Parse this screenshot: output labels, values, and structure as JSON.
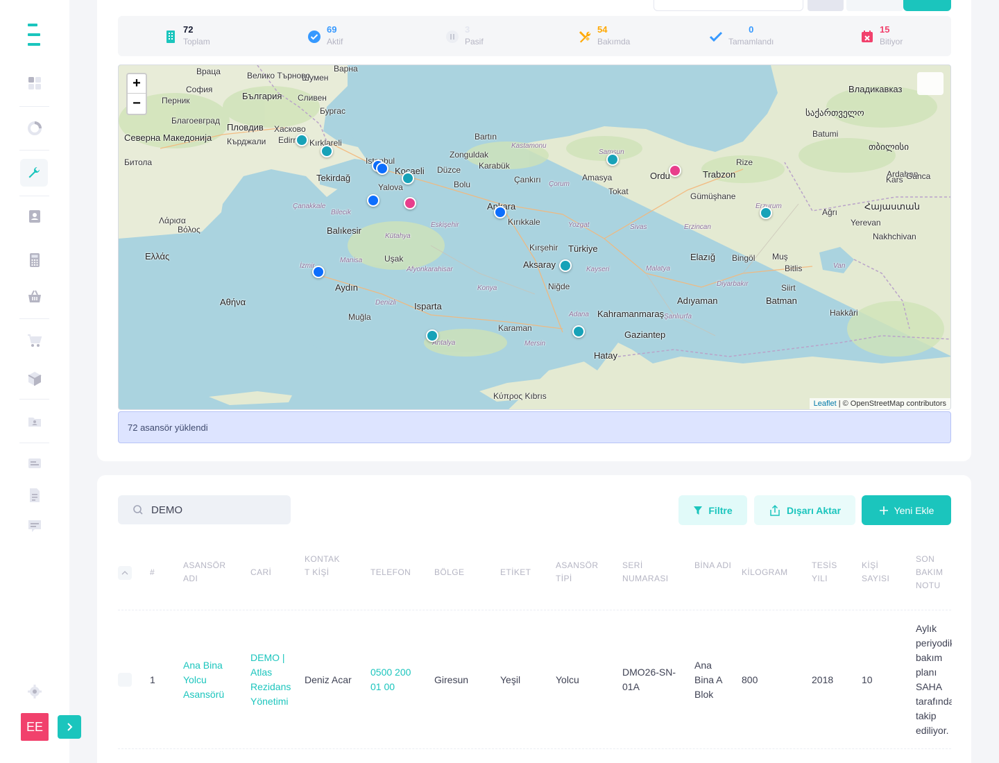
{
  "user": {
    "initials": "EE"
  },
  "stats": [
    {
      "key": "total",
      "value": "72",
      "label": "Toplam",
      "color": "#1bc5bd",
      "icon": "building-icon"
    },
    {
      "key": "active",
      "value": "69",
      "label": "Aktif",
      "color": "#3699ff",
      "icon": "check-circle-icon"
    },
    {
      "key": "passive",
      "value": "3",
      "label": "Pasif",
      "color": "#c5c8d3",
      "icon": "pause-circle-icon"
    },
    {
      "key": "maintenance",
      "value": "54",
      "label": "Bakımda",
      "color": "#ffa800",
      "icon": "tools-icon"
    },
    {
      "key": "completed",
      "value": "0",
      "label": "Tamamlandı",
      "color": "#3699ff",
      "icon": "check-icon"
    },
    {
      "key": "expiring",
      "value": "15",
      "label": "Bitiyor",
      "color": "#f1416c",
      "icon": "calendar-x-icon"
    }
  ],
  "map": {
    "attribution_link": "Leaflet",
    "attribution_text": " | © OpenStreetMap contributors",
    "zoom_in": "+",
    "zoom_out": "−",
    "labels": [
      "Варна",
      "Шумен",
      "Велико Търново",
      "Враца",
      "София",
      "България",
      "Перник",
      "Сливен",
      "Бургас",
      "Благоевград",
      "Пловдив",
      "Хасково",
      "Кърджали",
      "Edirne",
      "Северна Македонија",
      "Битола",
      "Kırklareli",
      "Tekirdağ",
      "Istanbul",
      "Kocaeli",
      "Yalova",
      "Düzce",
      "Bolu",
      "Zonguldak",
      "Bartın",
      "Kastamonu",
      "Karabük",
      "Çankırı",
      "Çorum",
      "Amasya",
      "Samsun",
      "Tokat",
      "Ordu",
      "Trabzon",
      "Rize",
      "Gümüşhane",
      "Erzurum",
      "Ağrı",
      "Ardahan",
      "Kars",
      "Ganca",
      "Batumi",
      "თბილისი",
      "საქართველო",
      "Владикавказ",
      "Ankara",
      "Kırıkkale",
      "Yozgat",
      "Sivas",
      "Erzincan",
      "Eskişehir",
      "Kütahya",
      "Balıkesir",
      "Çanakkale",
      "Bilecik",
      "Uşak",
      "Manisa",
      "İzmir",
      "Aydın",
      "Denizli",
      "Muğla",
      "Afyonkarahisar",
      "Isparta",
      "Antalya",
      "Konya",
      "Karaman",
      "Mersin",
      "Adana",
      "Hatay",
      "Gaziantep",
      "Kahramanmaraş",
      "Malatya",
      "Adıyaman",
      "Şanlıurfa",
      "Elazığ",
      "Bingöl",
      "Muş",
      "Bitlis",
      "Van",
      "Batman",
      "Siirt",
      "Hakkâri",
      "Diyarbakır",
      "Kayseri",
      "Niğde",
      "Aksaray",
      "Kırşehir",
      "Türkiye",
      "Ελλάς",
      "Αθήνα",
      "Λάρισα",
      "Βόλος",
      "Κύπρος Kıbrıs",
      "Nakhchivan",
      "Yerevan",
      "Հայաստան"
    ],
    "markers_color_teal": "#17a2b8",
    "markers_color_blue": "#0d6efd",
    "markers_color_pink": "#e83e8c"
  },
  "alert": {
    "text": "72 asansör yüklendi"
  },
  "toolbar": {
    "search_value": "DEMO",
    "filter_label": "Filtre",
    "export_label": "Dışarı Aktar",
    "add_label": "Yeni Ekle"
  },
  "table": {
    "headers": [
      "#",
      "ASANSÖR ADI",
      "CARİ",
      "KONTAK T KİŞİ",
      "TELEFON",
      "BÖLGE",
      "ETİKET",
      "ASANSÖR TİPİ",
      "SERİ NUMARASI",
      "BİNA ADI",
      "KİLOGRAM",
      "TESİS YILI",
      "KİŞİ SAYISI",
      "SON BAKIM NOTU"
    ],
    "rows": [
      {
        "no": "1",
        "name": "Ana Bina Yolcu Asansörü",
        "cari": "DEMO | Atlas Rezidans Yönetimi",
        "contact": "Deniz Acar",
        "phone": "0500 200 01 00",
        "region": "Giresun",
        "tag": "Yeşil",
        "type": "Yolcu",
        "serial": "DMO26-SN-01A",
        "building": "Ana Bina A Blok",
        "kg": "800",
        "year": "2018",
        "persons": "10",
        "note": "Aylık periyodik bakım planı SAHA tarafından takip ediliyor."
      }
    ]
  }
}
